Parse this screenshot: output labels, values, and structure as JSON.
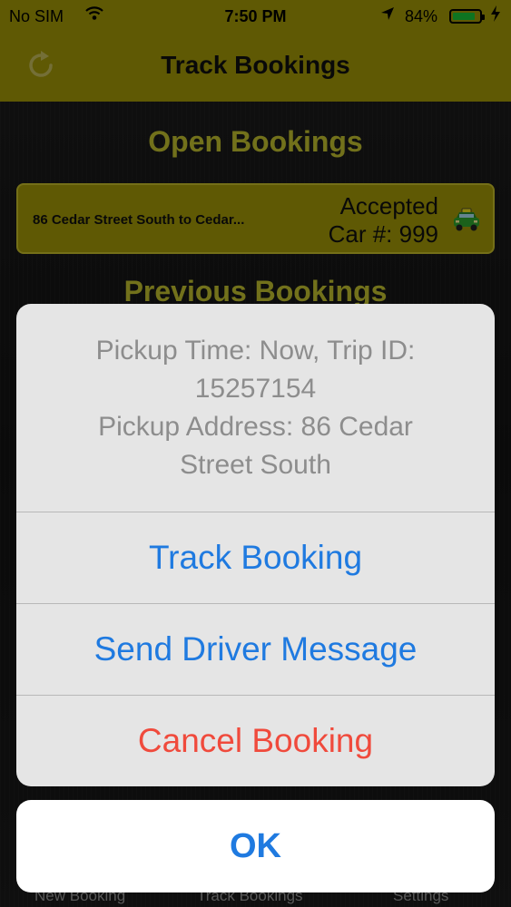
{
  "status_bar": {
    "carrier": "No SIM",
    "time": "7:50 PM",
    "battery": "84%",
    "battery_level": 0.84
  },
  "nav": {
    "title": "Track Bookings",
    "refresh_icon": "refresh-icon"
  },
  "open_bookings": {
    "title": "Open Bookings",
    "items": [
      {
        "route": "86 Cedar Street South to Cedar...",
        "status": "Accepted",
        "car": "Car #: 999",
        "icon": "taxi-icon"
      }
    ]
  },
  "previous_bookings": {
    "title": "Previous Bookings"
  },
  "tabbar": {
    "items": [
      "New Booking",
      "Track Bookings",
      "Settings"
    ]
  },
  "action_sheet": {
    "message_lines": [
      "Pickup Time: Now, Trip ID:",
      "15257154",
      "Pickup Address: 86 Cedar",
      "Street South"
    ],
    "actions": [
      "Track Booking",
      "Send Driver Message",
      "Cancel Booking"
    ],
    "ok_label": "OK"
  },
  "colors": {
    "header": "#a49a07",
    "accent_yellow": "#c4c330",
    "ios_blue": "#1f7ae0",
    "destructive_red": "#f04a3c"
  }
}
